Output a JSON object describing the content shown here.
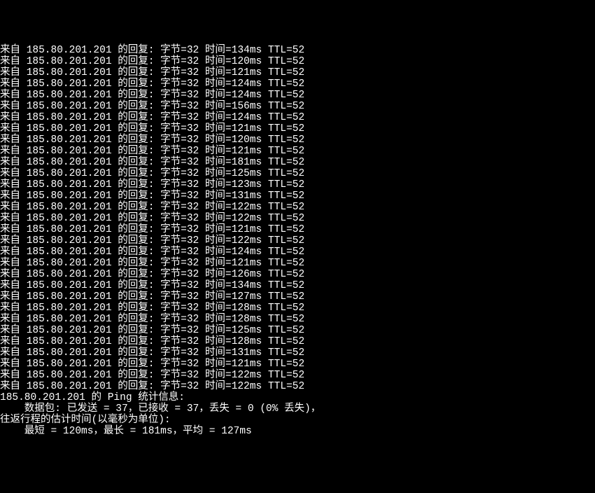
{
  "ping": {
    "ip": "185.80.201.201",
    "prefix": "来自 ",
    "reply_label": " 的回复: ",
    "bytes_label": "字节=",
    "bytes": "32",
    "time_label": " 时间=",
    "time_unit": "ms",
    "ttl_label": " TTL=",
    "ttl": "52",
    "replies": [
      {
        "time": "134"
      },
      {
        "time": "120"
      },
      {
        "time": "121"
      },
      {
        "time": "124"
      },
      {
        "time": "124"
      },
      {
        "time": "156"
      },
      {
        "time": "124"
      },
      {
        "time": "121"
      },
      {
        "time": "120"
      },
      {
        "time": "121"
      },
      {
        "time": "181"
      },
      {
        "time": "125"
      },
      {
        "time": "123"
      },
      {
        "time": "131"
      },
      {
        "time": "122"
      },
      {
        "time": "122"
      },
      {
        "time": "121"
      },
      {
        "time": "122"
      },
      {
        "time": "124"
      },
      {
        "time": "121"
      },
      {
        "time": "126"
      },
      {
        "time": "134"
      },
      {
        "time": "127"
      },
      {
        "time": "128"
      },
      {
        "time": "128"
      },
      {
        "time": "125"
      },
      {
        "time": "128"
      },
      {
        "time": "131"
      },
      {
        "time": "121"
      },
      {
        "time": "122"
      },
      {
        "time": "122"
      }
    ],
    "blank_line": "",
    "stats_header_suffix": " 的 Ping 统计信息:",
    "packets_line": "    数据包: 已发送 = 37，已接收 = 37，丢失 = 0 (0% 丢失)，",
    "roundtrip_line": "往返行程的估计时间(以毫秒为单位):",
    "minmax_line": "    最短 = 120ms，最长 = 181ms，平均 = 127ms"
  }
}
